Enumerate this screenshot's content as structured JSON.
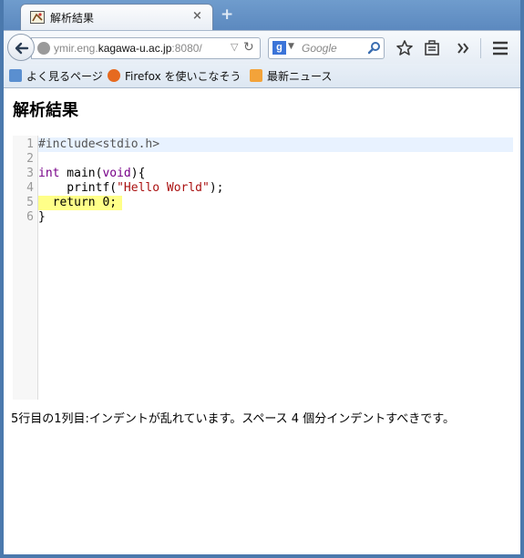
{
  "window": {
    "tab_title": "解析結果",
    "close_glyph": "×",
    "newtab_glyph": "+"
  },
  "navbar": {
    "url_prefix": "ymir.eng.",
    "url_host": "kagawa-u.ac.jp",
    "url_suffix": ":8080/",
    "search_placeholder": "Google",
    "search_engine_letter": "g"
  },
  "bookmarks": [
    {
      "label": "よく見るページ",
      "icon": "most-visited-icon",
      "color": "#5a8fd0"
    },
    {
      "label": "Firefox を使いこなそう",
      "icon": "firefox-icon",
      "color": "#e66a1f"
    },
    {
      "label": "最新ニュース",
      "icon": "rss-icon",
      "color": "#f3a33a"
    }
  ],
  "page": {
    "title": "解析結果",
    "message": "5行目の1列目:インデントが乱れています。スペース 4 個分インデントすべきです。"
  },
  "code": {
    "lines": [
      {
        "no": "1",
        "text": "#include<stdio.h>"
      },
      {
        "no": "2",
        "text": ""
      },
      {
        "no": "3",
        "text": "int main(void){"
      },
      {
        "no": "4",
        "text": "    printf(\"Hello World\");"
      },
      {
        "no": "5",
        "text": "  return 0;"
      },
      {
        "no": "6",
        "text": "}"
      }
    ],
    "tokens": {
      "l1": "#include<stdio.h>",
      "l3_kw1": "int",
      "l3_mid": " main(",
      "l3_kw2": "void",
      "l3_end": "){",
      "l4_pre": "    printf(",
      "l4_str": "\"Hello World\"",
      "l4_end": ");",
      "l5": "  return 0;",
      "l6": "}"
    }
  },
  "colors": {
    "frame": "#4b79ad",
    "active_line": "#e8f2ff",
    "error_line": "#ffff88",
    "keyword": "#770088",
    "string": "#aa1111"
  }
}
